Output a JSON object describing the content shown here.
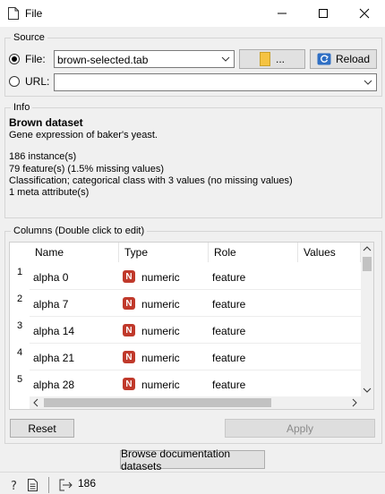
{
  "window": {
    "title": "File"
  },
  "source": {
    "group_label": "Source",
    "file_label": "File:",
    "file_value": "brown-selected.tab",
    "browse_label": "...",
    "reload_label": "Reload",
    "url_label": "URL:",
    "url_value": ""
  },
  "info": {
    "group_label": "Info",
    "name": "Brown dataset",
    "description": "Gene expression of baker's yeast.",
    "lines": [
      "186 instance(s)",
      "79 feature(s) (1.5% missing values)",
      "Classification; categorical class with 3 values (no missing values)",
      "1 meta attribute(s)"
    ]
  },
  "columns": {
    "group_label": "Columns (Double click to edit)",
    "headers": [
      "Name",
      "Type",
      "Role",
      "Values"
    ],
    "rows": [
      {
        "num": "1",
        "name": "alpha 0",
        "type_badge": "N",
        "type": "numeric",
        "role": "feature",
        "values": ""
      },
      {
        "num": "2",
        "name": "alpha 7",
        "type_badge": "N",
        "type": "numeric",
        "role": "feature",
        "values": ""
      },
      {
        "num": "3",
        "name": "alpha 14",
        "type_badge": "N",
        "type": "numeric",
        "role": "feature",
        "values": ""
      },
      {
        "num": "4",
        "name": "alpha 21",
        "type_badge": "N",
        "type": "numeric",
        "role": "feature",
        "values": ""
      },
      {
        "num": "5",
        "name": "alpha 28",
        "type_badge": "N",
        "type": "numeric",
        "role": "feature",
        "values": ""
      }
    ],
    "reset_label": "Reset",
    "apply_label": "Apply"
  },
  "browse_docs_label": "Browse documentation datasets",
  "status_bar": {
    "output_count": "186"
  },
  "colors": {
    "numeric_badge": "#c0392b",
    "folder": "#f5c342",
    "reload": "#2f6fc4"
  }
}
